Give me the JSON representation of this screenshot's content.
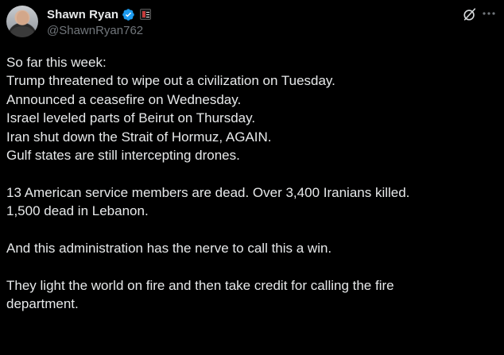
{
  "author": {
    "display_name": "Shawn Ryan",
    "handle": "@ShawnRyan762",
    "verified": true,
    "verified_color": "#1d9bf0"
  },
  "icons": {
    "top_right": [
      "grok-icon",
      "more-icon"
    ]
  },
  "tweet": {
    "paragraphs": [
      "So far this week:\nTrump threatened to wipe out a civilization on Tuesday.\nAnnounced a ceasefire on Wednesday.\nIsrael leveled parts of Beirut on Thursday.\nIran shut down the Strait of Hormuz, AGAIN.\nGulf states are still intercepting drones.",
      "13 American service members are dead. Over 3,400 Iranians killed.\n1,500 dead in Lebanon.",
      "And this administration has the nerve to call this a win.",
      "They light the world on fire and then take credit for calling the fire\ndepartment."
    ]
  },
  "colors": {
    "background": "#000000",
    "text_primary": "#e7e9ea",
    "text_secondary": "#71767b"
  }
}
